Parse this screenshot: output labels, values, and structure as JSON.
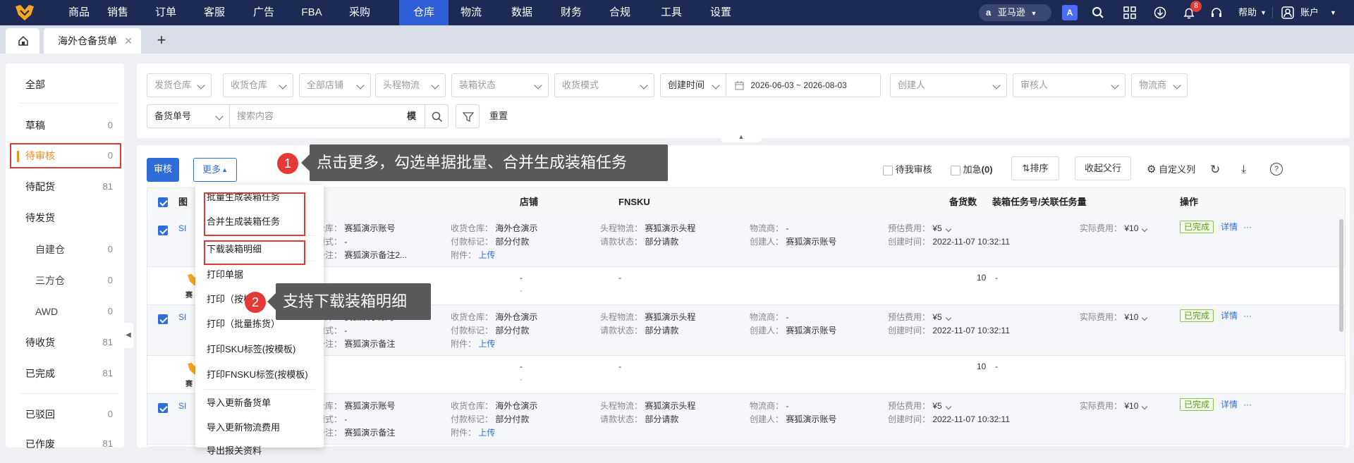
{
  "brand": {
    "accent": "#2f6ed8",
    "nav_bg": "#1d2b54",
    "active_nav": "#2f5fd6",
    "highlight_red": "#e53935",
    "sidebar_active": "#f09020"
  },
  "topnav": {
    "items": [
      "商品",
      "销售",
      "订单",
      "客服",
      "广告",
      "FBA",
      "采购",
      "仓库",
      "物流",
      "数据",
      "财务",
      "合规",
      "工具",
      "设置"
    ],
    "active": "仓库",
    "marketplace": "亚马逊",
    "notifications": "8",
    "help": "帮助",
    "account": "账户"
  },
  "tabs": {
    "current": "海外仓备货单"
  },
  "sidebar": {
    "items": [
      {
        "label": "全部",
        "count": ""
      },
      {
        "label": "草稿",
        "count": "0"
      },
      {
        "label": "待审核",
        "count": "0"
      },
      {
        "label": "待配货",
        "count": "81"
      },
      {
        "label": "待发货",
        "count": ""
      },
      {
        "label": "自建仓",
        "count": "0"
      },
      {
        "label": "三方仓",
        "count": "0"
      },
      {
        "label": "AWD",
        "count": "0"
      },
      {
        "label": "待收货",
        "count": "81"
      },
      {
        "label": "已完成",
        "count": "81"
      },
      {
        "label": "已驳回",
        "count": "0"
      },
      {
        "label": "已作废",
        "count": "81"
      }
    ]
  },
  "filters": {
    "ship_warehouse": "发货仓库",
    "receive_warehouse": "收货仓库",
    "all_shops": "全部店铺",
    "first_leg": "头程物流",
    "packing_status": "装箱状态",
    "receive_mode": "收货模式",
    "time_type": "创建时间",
    "date_range": "2026-06-03 ~ 2026-08-03",
    "creator": "创建人",
    "reviewer": "审核人",
    "carrier": "物流商",
    "order_field": "备货单号",
    "search_placeholder": "搜索内容",
    "mode": "模",
    "reset": "重置"
  },
  "toolbar": {
    "approve": "审核",
    "more": "更多",
    "pending_me": "待我审核",
    "urgent_label": "加急",
    "urgent_count": "(0)",
    "sort": "排序",
    "collapse_parent": "收起父行",
    "custom_cols": "自定义列"
  },
  "table": {
    "headers": {
      "image": "图",
      "shop": "店铺",
      "fnsku": "FNSKU",
      "qty": "备货数",
      "box_task": "装箱任务号/关联任务量",
      "ops": "操作"
    },
    "rows": [
      {
        "sku": "SI",
        "ship_wh": "赛狐演示账号",
        "receive_mode": "-",
        "note": "赛狐演示备注2...",
        "recv_wh": "海外仓演示",
        "pay_mark": "部分付款",
        "attach": "上传",
        "first_leg": "赛狐演示头程",
        "pay_status": "部分请款",
        "carrier": "-",
        "creator": "赛狐演示账号",
        "est_fee": "¥5",
        "actual_fee": "¥10",
        "created": "2022-11-07 10:32:11",
        "status": "已完成",
        "detail": "详情"
      },
      {
        "sku": "SI",
        "ship_wh": "赛狐演示账号",
        "receive_mode": "-",
        "note": "赛狐演示备注",
        "recv_wh": "海外仓演示",
        "pay_mark": "部分付款",
        "attach": "上传",
        "first_leg": "赛狐演示头程",
        "pay_status": "部分请款",
        "carrier": "-",
        "creator": "赛狐演示账号",
        "est_fee": "¥5",
        "actual_fee": "¥10",
        "created": "2022-11-07 10:32:11",
        "status": "已完成",
        "detail": "详情"
      },
      {
        "sku": "SI",
        "ship_wh": "赛狐演示账号",
        "receive_mode": "-",
        "note": "赛狐演示备注",
        "recv_wh": "海外仓演示",
        "pay_mark": "部分付款",
        "attach": "上传",
        "first_leg": "赛狐演示头程",
        "pay_status": "部分请款",
        "carrier": "-",
        "creator": "赛狐演示账号",
        "est_fee": "¥5",
        "actual_fee": "¥10",
        "created": "2022-11-07 10:32:11",
        "status": "已完成",
        "detail": "详情"
      }
    ],
    "labels": {
      "ship_wh": "发货仓库：",
      "receive_mode": "收货模式：",
      "note": "单据备注：",
      "recv_wh": "收货仓库：",
      "pay_mark": "付款标记：",
      "attach": "附件：",
      "first_leg": "头程物流：",
      "pay_status": "请款状态：",
      "carrier": "物流商：",
      "creator": "创建人：",
      "est_fee": "预估费用：",
      "actual_fee": "实际费用：",
      "created": "创建时间："
    },
    "child": {
      "dash": "-",
      "qty": "10",
      "shop_tag": "赛"
    }
  },
  "more_menu": {
    "items": [
      "批量生成装箱任务",
      "合并生成装箱任务",
      "下载装箱明细",
      "打印单据",
      "打印（按模板）",
      "打印（批量拣货）",
      "打印SKU标签(按模板)",
      "打印FNSKU标签(按模板)",
      "导入更新备货单",
      "导入更新物流费用",
      "导出报关资料"
    ]
  },
  "callouts": [
    {
      "num": "1",
      "text": "点击更多，勾选单据批量、合并生成装箱任务"
    },
    {
      "num": "2",
      "text": "支持下载装箱明细"
    }
  ]
}
